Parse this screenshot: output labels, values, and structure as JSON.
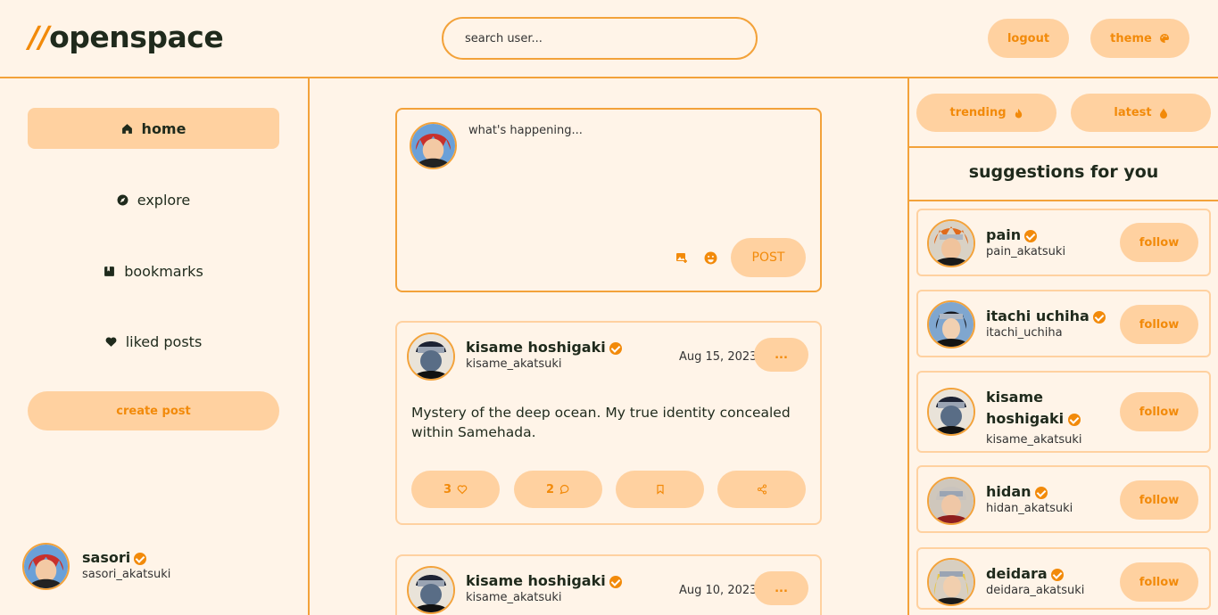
{
  "header": {
    "logo_slash": "//",
    "logo_text": "openspace",
    "search_placeholder": "search user...",
    "logout_label": "logout",
    "theme_label": "theme"
  },
  "sidebar": {
    "items": [
      {
        "label": "home",
        "icon": "home-icon",
        "active": true
      },
      {
        "label": "explore",
        "icon": "compass-icon"
      },
      {
        "label": "bookmarks",
        "icon": "bookmark-icon"
      },
      {
        "label": "liked posts",
        "icon": "heart-icon"
      }
    ],
    "create_post_label": "create post",
    "profile": {
      "name": "sasori",
      "handle": "sasori_akatsuki"
    }
  },
  "composer": {
    "placeholder": "what's happening...",
    "post_label": "POST"
  },
  "posts": [
    {
      "name": "kisame hoshigaki",
      "handle": "kisame_akatsuki",
      "date": "Aug 15, 2023",
      "text": "Mystery of the deep ocean. My true identity concealed within Samehada.",
      "likes": "3",
      "comments": "2",
      "more_label": "..."
    },
    {
      "name": "kisame hoshigaki",
      "handle": "kisame_akatsuki",
      "date": "Aug 10, 2023",
      "more_label": "..."
    }
  ],
  "right": {
    "trending_label": "trending",
    "latest_label": "latest",
    "suggestions_title": "suggestions for you",
    "follow_label": "follow",
    "suggestions": [
      {
        "name": "pain",
        "handle": "pain_akatsuki"
      },
      {
        "name": "itachi uchiha",
        "handle": "itachi_uchiha"
      },
      {
        "name": "kisame hoshigaki",
        "handle": "kisame_akatsuki"
      },
      {
        "name": "hidan",
        "handle": "hidan_akatsuki"
      },
      {
        "name": "deidara",
        "handle": "deidara_akatsuki"
      }
    ]
  },
  "colors": {
    "accent": "#f28a0a",
    "pill": "#ffd1a0",
    "background": "#fff4e8",
    "border": "#f3a23a"
  }
}
